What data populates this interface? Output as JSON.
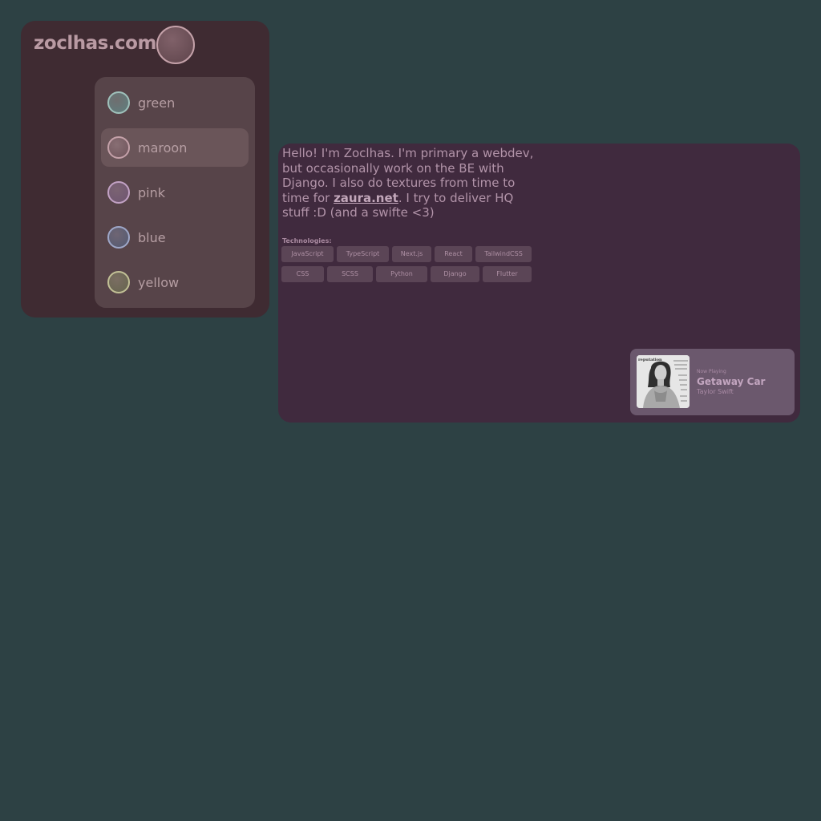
{
  "header": {
    "site_title": "zoclhas.com"
  },
  "theme_menu": {
    "selected": "maroon",
    "options": [
      {
        "label": "green",
        "swatch": "#5f7f7f",
        "ring": "#9fc1bb"
      },
      {
        "label": "maroon",
        "swatch": "#6f545b",
        "ring": "#c4a1a9"
      },
      {
        "label": "pink",
        "swatch": "#6f5571",
        "ring": "#c2a2c4"
      },
      {
        "label": "blue",
        "swatch": "#535a73",
        "ring": "#9ea7c8"
      },
      {
        "label": "yellow",
        "swatch": "#66654e",
        "ring": "#c2c096"
      }
    ]
  },
  "about": {
    "intro_before": "Hello! I'm Zoclhas. I'm primary a webdev, but occasionally work on the BE with Django. I also do textures from time to time for ",
    "intro_link": "zaura.net",
    "intro_after": ". I try to deliver HQ stuff :D (and a swifte <3)",
    "technologies_heading": "Technologies:",
    "technologies_row1": [
      "JavaScript",
      "TypeScript",
      "Next.js",
      "React",
      "TailwindCSS"
    ],
    "technologies_row2": [
      "CSS",
      "SCSS",
      "Python",
      "Django",
      "Flutter"
    ]
  },
  "now_playing": {
    "label": "Now Playing",
    "title": "Getaway Car",
    "artist": "Taylor Swift",
    "album_text": "reputation"
  }
}
